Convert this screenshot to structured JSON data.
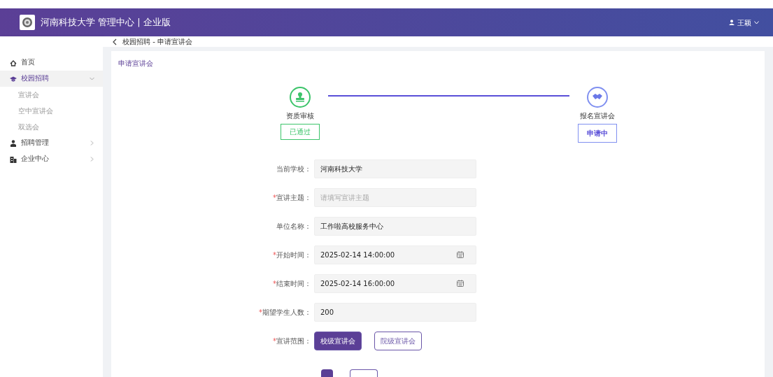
{
  "header": {
    "title": "河南科技大学 管理中心 | 企业版",
    "user": "王颖"
  },
  "sidebar": {
    "items": [
      {
        "kind": "home",
        "label": "首页",
        "selected": false
      },
      {
        "kind": "cap",
        "label": "校园招聘",
        "selected": true,
        "expanded": true,
        "children": [
          {
            "label": "宣讲会"
          },
          {
            "label": "空中宣讲会"
          },
          {
            "label": "双选会"
          }
        ]
      },
      {
        "kind": "person",
        "label": "招聘管理",
        "selected": false,
        "expanded": false
      },
      {
        "kind": "building",
        "label": "企业中心",
        "selected": false,
        "expanded": false
      }
    ]
  },
  "breadcrumb": "校园招聘 - 申请宣讲会",
  "card_title": "申请宣讲会",
  "steps": [
    {
      "kind": "stamp",
      "label": "资质审核",
      "status": "已通过",
      "completed": true
    },
    {
      "kind": "handshake",
      "label": "报名宣讲会",
      "status": "申请中",
      "completed": false
    }
  ],
  "fields": [
    {
      "kind": "text",
      "label": "当前学校：",
      "value": "河南科技大学"
    },
    {
      "kind": "text",
      "label": "宣讲主题：",
      "required_mark": "*",
      "placeholder": "请填写宣讲主题"
    },
    {
      "kind": "text",
      "label": "单位名称：",
      "value": "工作啦高校服务中心"
    },
    {
      "kind": "date",
      "label": "开始时间：",
      "required_mark": "*",
      "value": "2025-02-14 14:00:00"
    },
    {
      "kind": "date",
      "label": "结束时间：",
      "required_mark": "*",
      "value": "2025-02-14 16:00:00"
    },
    {
      "kind": "text",
      "label": "期望学生人数：",
      "required_mark": "*",
      "value": "200"
    }
  ],
  "scope": {
    "label": "宣讲范围：",
    "required_mark": "*",
    "options": [
      {
        "label": "校级宣讲会",
        "selected": true
      },
      {
        "label": "院级宣讲会",
        "selected": false
      }
    ]
  }
}
